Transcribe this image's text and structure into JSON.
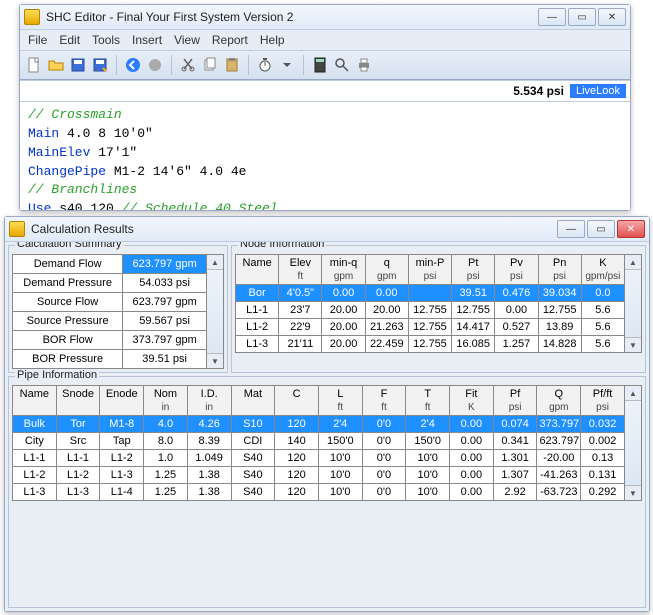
{
  "editor": {
    "title": "SHC Editor - Final Your First System Version 2",
    "menus": [
      "File",
      "Edit",
      "Tools",
      "Insert",
      "View",
      "Report",
      "Help"
    ],
    "status_value": "5.534 psi",
    "livelook": "LiveLook",
    "code_lines": [
      {
        "cls": "cm",
        "text": "// Crossmain"
      },
      {
        "spans": [
          {
            "cls": "kw",
            "text": "Main"
          },
          {
            "cls": "",
            "text": " 4.0 8 10'0\""
          }
        ]
      },
      {
        "spans": [
          {
            "cls": "kw",
            "text": "MainElev"
          },
          {
            "cls": "",
            "text": " 17'1\""
          }
        ]
      },
      {
        "spans": [
          {
            "cls": "kw",
            "text": "ChangePipe"
          },
          {
            "cls": "",
            "text": " M1-2 14'6\" 4.0 4e"
          }
        ]
      },
      {
        "spans": [
          {
            "cls": "",
            "text": ""
          }
        ]
      },
      {
        "cls": "cm",
        "text": "// Branchlines"
      },
      {
        "spans": [
          {
            "cls": "kw",
            "text": "Use"
          },
          {
            "cls": "",
            "text": " s40 120 "
          },
          {
            "cls": "cm",
            "text": "// Schedule 40 Steel"
          }
        ]
      }
    ]
  },
  "results": {
    "title": "Calculation Results",
    "summary_legend": "Calculation Summary",
    "node_legend": "Node Information",
    "pipe_legend": "Pipe Information",
    "summary": [
      {
        "label": "Demand Flow",
        "value": "623.797 gpm",
        "sel": true
      },
      {
        "label": "Demand Pressure",
        "value": "54.033 psi"
      },
      {
        "label": "Source Flow",
        "value": "623.797 gpm"
      },
      {
        "label": "Source Pressure",
        "value": "59.567 psi"
      },
      {
        "label": "BOR Flow",
        "value": "373.797 gpm"
      },
      {
        "label": "BOR Pressure",
        "value": "39.51 psi"
      }
    ],
    "node_headers": [
      {
        "h": "Name",
        "u": ""
      },
      {
        "h": "Elev",
        "u": "ft"
      },
      {
        "h": "min-q",
        "u": "gpm"
      },
      {
        "h": "q",
        "u": "gpm"
      },
      {
        "h": "min-P",
        "u": "psi"
      },
      {
        "h": "Pt",
        "u": "psi"
      },
      {
        "h": "Pv",
        "u": "psi"
      },
      {
        "h": "Pn",
        "u": "psi"
      },
      {
        "h": "K",
        "u": "gpm/psi"
      }
    ],
    "node_rows": [
      {
        "sel": true,
        "c": [
          "Bor",
          "4'0.5\"",
          "0.00",
          "0.00",
          "",
          "39.51",
          "0.476",
          "39.034",
          "0.0"
        ]
      },
      {
        "c": [
          "L1-1",
          "23'7",
          "20.00",
          "20.00",
          "12.755",
          "12.755",
          "0.00",
          "12.755",
          "5.6"
        ]
      },
      {
        "c": [
          "L1-2",
          "22'9",
          "20.00",
          "21.263",
          "12.755",
          "14.417",
          "0.527",
          "13.89",
          "5.6"
        ]
      },
      {
        "c": [
          "L1-3",
          "21'11",
          "20.00",
          "22.459",
          "12.755",
          "16.085",
          "1.257",
          "14.828",
          "5.6"
        ]
      }
    ],
    "pipe_headers": [
      {
        "h": "Name",
        "u": ""
      },
      {
        "h": "Snode",
        "u": ""
      },
      {
        "h": "Enode",
        "u": ""
      },
      {
        "h": "Nom",
        "u": "in"
      },
      {
        "h": "I.D.",
        "u": "in"
      },
      {
        "h": "Mat",
        "u": ""
      },
      {
        "h": "C",
        "u": ""
      },
      {
        "h": "L",
        "u": "ft"
      },
      {
        "h": "F",
        "u": "ft"
      },
      {
        "h": "T",
        "u": "ft"
      },
      {
        "h": "Fit",
        "u": "K"
      },
      {
        "h": "Pf",
        "u": "psi"
      },
      {
        "h": "Q",
        "u": "gpm"
      },
      {
        "h": "Pf/ft",
        "u": "psi"
      }
    ],
    "pipe_rows": [
      {
        "sel": true,
        "c": [
          "Bulk",
          "Tor",
          "M1-8",
          "4.0",
          "4.26",
          "S10",
          "120",
          "2'4",
          "0'0",
          "2'4",
          "0.00",
          "0.074",
          "373.797",
          "0.032"
        ]
      },
      {
        "c": [
          "City",
          "Src",
          "Tap",
          "8.0",
          "8.39",
          "CDI",
          "140",
          "150'0",
          "0'0",
          "150'0",
          "0.00",
          "0.341",
          "623.797",
          "0.002"
        ]
      },
      {
        "c": [
          "L1-1",
          "L1-1",
          "L1-2",
          "1.0",
          "1.049",
          "S40",
          "120",
          "10'0",
          "0'0",
          "10'0",
          "0.00",
          "1.301",
          "-20.00",
          "0.13"
        ]
      },
      {
        "c": [
          "L1-2",
          "L1-2",
          "L1-3",
          "1.25",
          "1.38",
          "S40",
          "120",
          "10'0",
          "0'0",
          "10'0",
          "0.00",
          "1.307",
          "-41.263",
          "0.131"
        ]
      },
      {
        "c": [
          "L1-3",
          "L1-3",
          "L1-4",
          "1.25",
          "1.38",
          "S40",
          "120",
          "10'0",
          "0'0",
          "10'0",
          "0.00",
          "2.92",
          "-63.723",
          "0.292"
        ]
      }
    ]
  },
  "chart_data": {
    "type": "table"
  }
}
